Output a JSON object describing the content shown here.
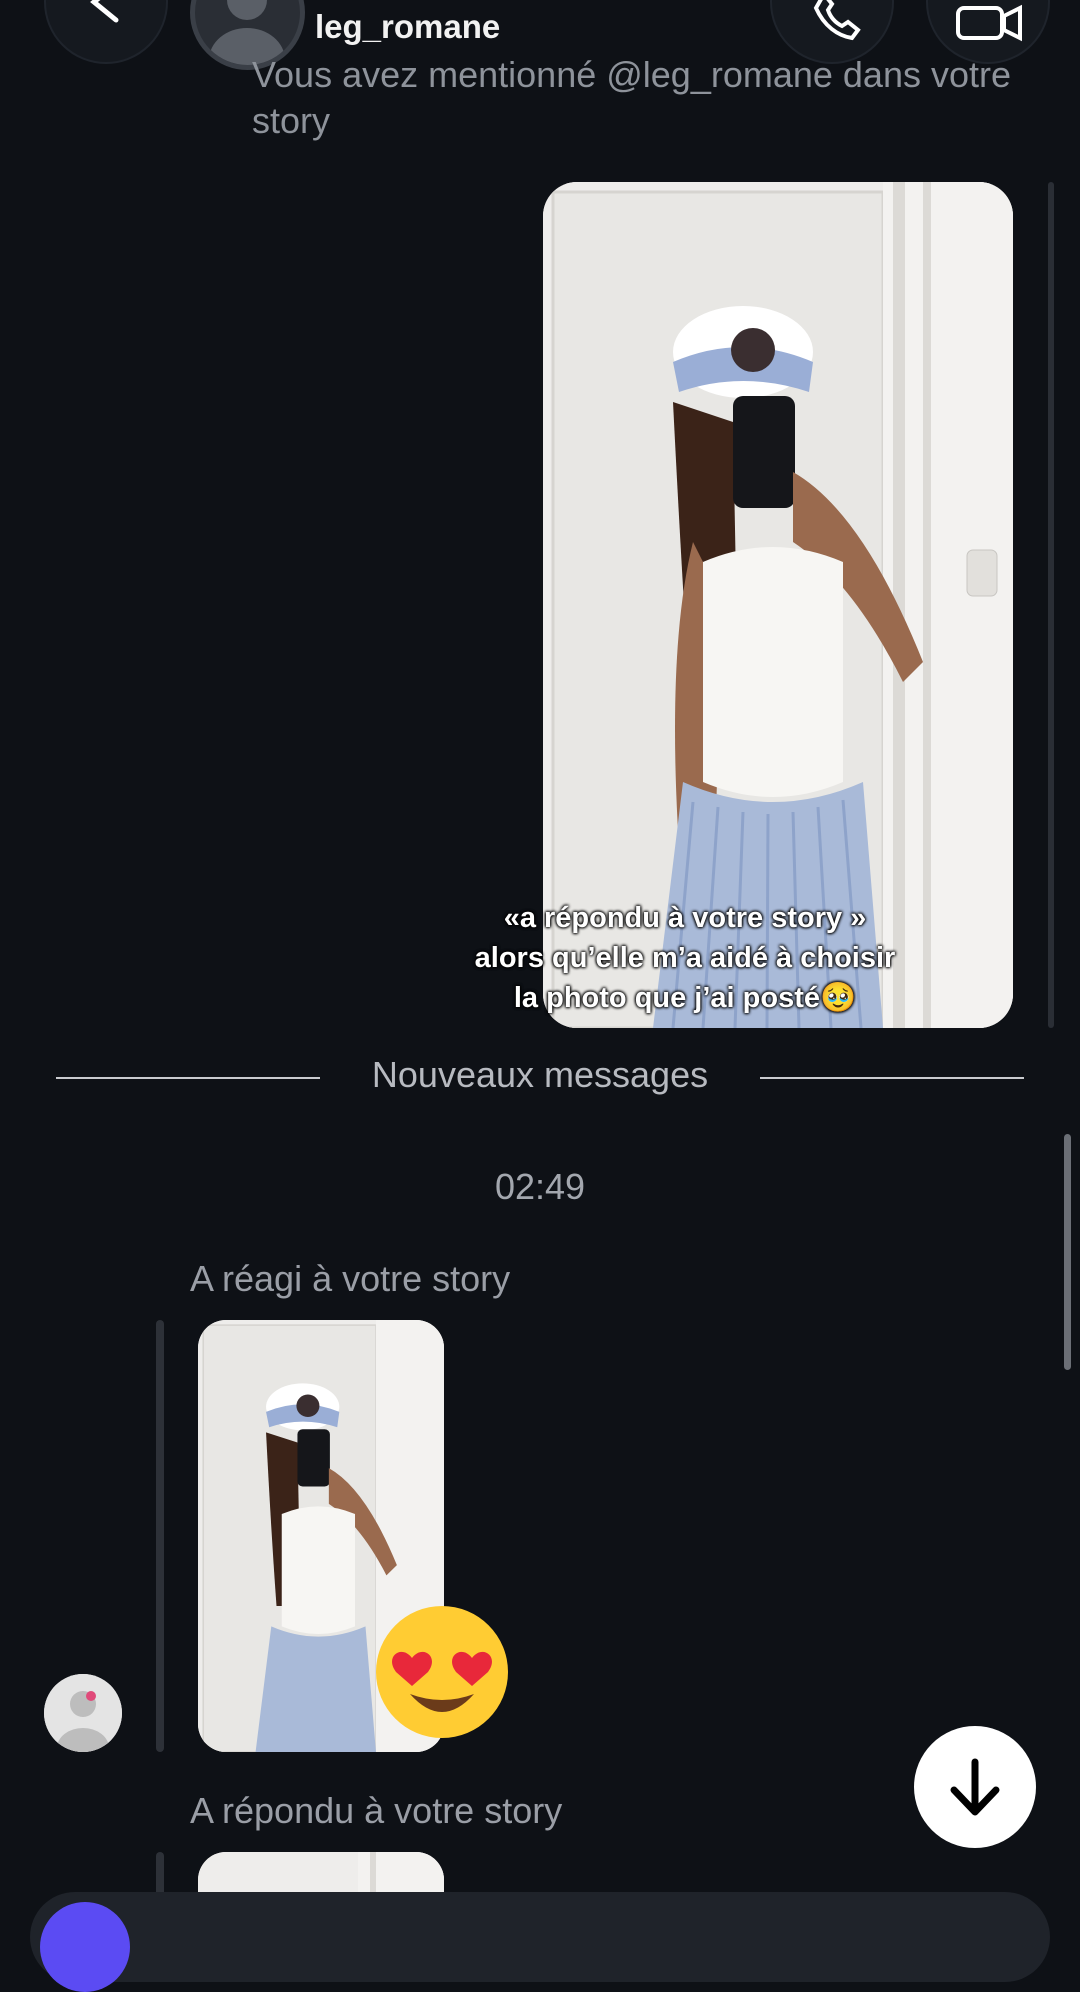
{
  "header": {
    "username": "leg_romane",
    "icons": {
      "back": "back-arrow-icon",
      "call": "phone-icon",
      "video": "video-camera-icon"
    }
  },
  "mention_text": "Vous avez mentionné @leg_romane dans votre story",
  "story_caption": {
    "line1": "«a répondu à votre story »",
    "line2": "alors qu’elle m’a aidé à choisir",
    "line3": "la photo que j’ai posté🥹"
  },
  "divider_label": "Nouveaux messages",
  "timestamp": "02:49",
  "reacted_label": "A réagi à votre story",
  "reaction_emoji": "heart-eyes-emoji",
  "replied_label": "A répondu à votre story",
  "colors": {
    "background": "#0e1116",
    "composer_accent": "#5b4bf3"
  }
}
